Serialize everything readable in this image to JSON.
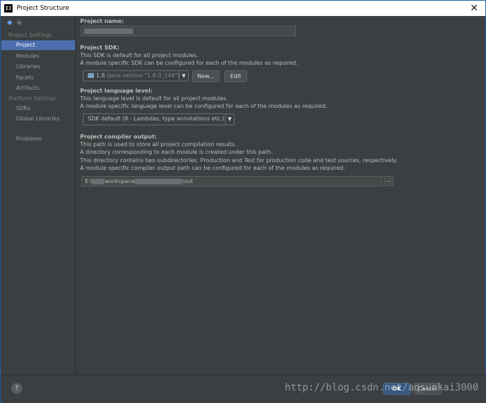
{
  "window": {
    "title": "Project Structure",
    "logo": "IJ"
  },
  "sidebar": {
    "project_settings_header": "Project Settings",
    "platform_settings_header": "Platform Settings",
    "items": [
      {
        "label": "Project"
      },
      {
        "label": "Modules"
      },
      {
        "label": "Libraries"
      },
      {
        "label": "Facets"
      },
      {
        "label": "Artifacts"
      },
      {
        "label": "SDKs"
      },
      {
        "label": "Global Libraries"
      },
      {
        "label": "Problems"
      }
    ]
  },
  "project_name": {
    "label": "Project name:"
  },
  "project_sdk": {
    "label": "Project SDK:",
    "desc1": "This SDK is default for all project modules.",
    "desc2": "A module specific SDK can be configured for each of the modules as required.",
    "selected_version": "1.8",
    "selected_detail": "(java version \"1.8.0_144\")",
    "new_button": "New...",
    "edit_button": "Edit"
  },
  "language_level": {
    "label": "Project language level:",
    "desc1": "This language level is default for all project modules.",
    "desc2": "A module specific language level can be configured for each of the modules as required.",
    "selected": "SDK default (8 - Lambdas, type annotations etc.)"
  },
  "compiler_output": {
    "label": "Project compiler output:",
    "desc1": "This path is used to store all project compilation results.",
    "desc2": "A directory corresponding to each module is created under this path.",
    "desc3": "This directory contains two subdirectories: Production and Test for production code and test sources, respectively.",
    "desc4": "A module specific compiler output path can be configured for each of the modules as required.",
    "path_prefix": "E:\\",
    "path_mid": "workspace",
    "path_suffix": "\\out",
    "browse_label": "..."
  },
  "footer": {
    "help": "?",
    "ok": "OK",
    "cancel": "Cancel",
    "watermark": "http://blog.csdn.net/aqsunkai3000"
  }
}
